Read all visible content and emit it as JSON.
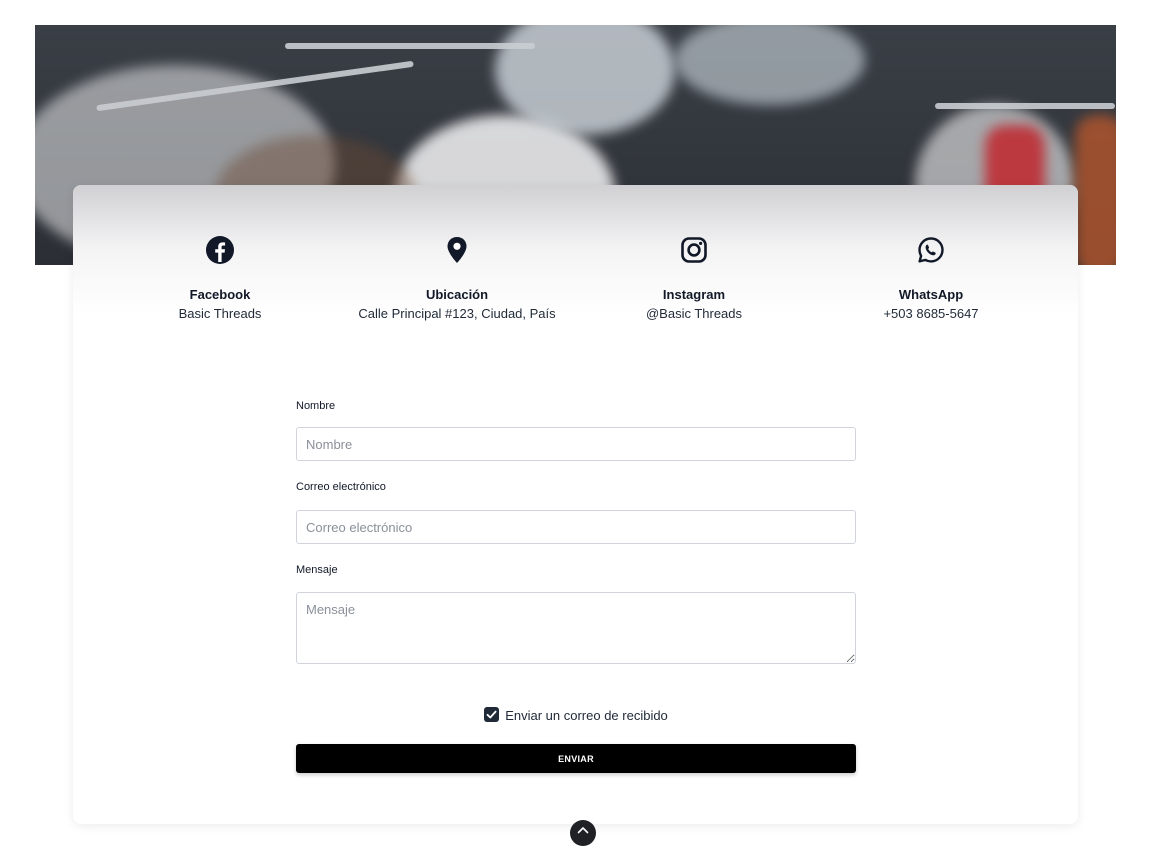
{
  "contacts": [
    {
      "icon": "facebook-icon",
      "title": "Facebook",
      "value": "Basic Threads"
    },
    {
      "icon": "location-pin-icon",
      "title": "Ubicación",
      "value": "Calle Principal #123, Ciudad, País"
    },
    {
      "icon": "instagram-icon",
      "title": "Instagram",
      "value": "@Basic Threads"
    },
    {
      "icon": "whatsapp-icon",
      "title": "WhatsApp",
      "value": "+503 8685-5647"
    }
  ],
  "form": {
    "name_label": "Nombre",
    "name_placeholder": "Nombre",
    "email_label": "Correo electrónico",
    "email_placeholder": "Correo electrónico",
    "message_label": "Mensaje",
    "message_placeholder": "Mensaje",
    "receipt_checkbox_label": "Enviar un correo de recibido",
    "receipt_checked": true,
    "submit_label": "ENVIAR"
  },
  "colors": {
    "icon": "#111827",
    "button_bg": "#000000",
    "button_text": "#ffffff"
  }
}
